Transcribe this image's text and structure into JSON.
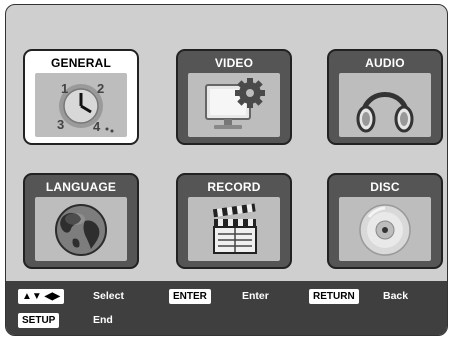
{
  "menu": {
    "tiles": [
      {
        "label": "GENERAL",
        "icon": "clock-icon",
        "selected": true
      },
      {
        "label": "VIDEO",
        "icon": "monitor-gear-icon",
        "selected": false
      },
      {
        "label": "AUDIO",
        "icon": "headphones-icon",
        "selected": false
      },
      {
        "label": "LANGUAGE",
        "icon": "globe-icon",
        "selected": false
      },
      {
        "label": "RECORD",
        "icon": "clapperboard-icon",
        "selected": false
      },
      {
        "label": "DISC",
        "icon": "disc-icon",
        "selected": false
      }
    ]
  },
  "legend": {
    "arrows_key": "▲▼ ◀▶",
    "select_label": "Select",
    "enter_key": "ENTER",
    "enter_label": "Enter",
    "return_key": "RETURN",
    "return_label": "Back",
    "setup_key": "SETUP",
    "setup_label": "End"
  },
  "colors": {
    "background": "#cfcfcf",
    "tile": "#555555",
    "selected_tile": "#ffffff",
    "bar": "#3f3f3f"
  }
}
